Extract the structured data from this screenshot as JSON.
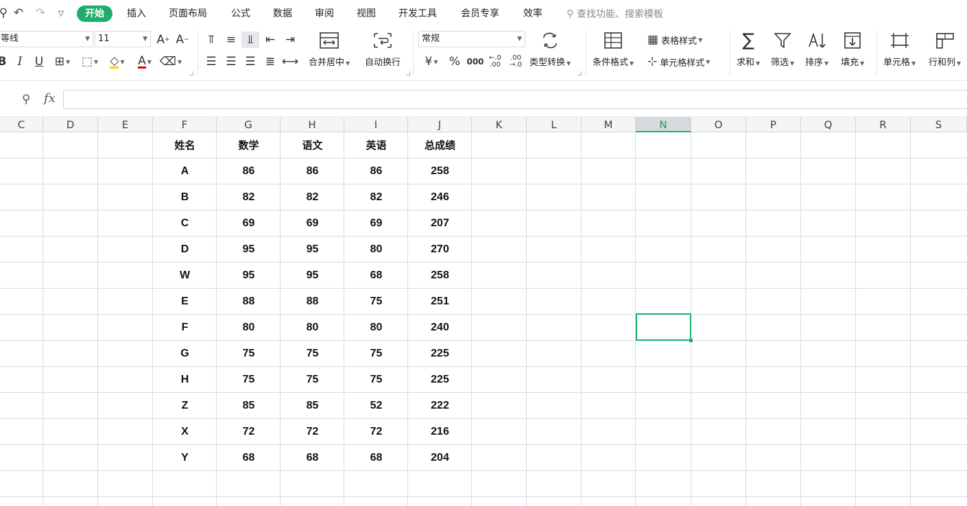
{
  "menubar": {
    "items": [
      "开始",
      "插入",
      "页面布局",
      "公式",
      "数据",
      "审阅",
      "视图",
      "开发工具",
      "会员专享",
      "效率"
    ],
    "active_index": 0,
    "search_placeholder": "查找功能、搜索模板"
  },
  "ribbon": {
    "font_name": "等线",
    "font_size": "11",
    "number_format": "常规",
    "merge_center": "合并居中",
    "auto_wrap": "自动换行",
    "type_convert": "类型转换",
    "conditional_format": "条件格式",
    "table_style": "表格样式",
    "cell_style": "单元格样式",
    "sum": "求和",
    "filter": "筛选",
    "sort": "排序",
    "fill": "填充",
    "cell": "单元格",
    "row_col": "行和列"
  },
  "formula_bar": {
    "fx": "fx",
    "value": ""
  },
  "columns": [
    "C",
    "D",
    "E",
    "F",
    "G",
    "H",
    "I",
    "J",
    "K",
    "L",
    "M",
    "N",
    "O",
    "P",
    "Q",
    "R",
    "S"
  ],
  "selected_column": "N",
  "table": {
    "headers": [
      "姓名",
      "数学",
      "语文",
      "英语",
      "总成绩"
    ],
    "rows": [
      [
        "A",
        "86",
        "86",
        "86",
        "258"
      ],
      [
        "B",
        "82",
        "82",
        "82",
        "246"
      ],
      [
        "C",
        "69",
        "69",
        "69",
        "207"
      ],
      [
        "D",
        "95",
        "95",
        "80",
        "270"
      ],
      [
        "W",
        "95",
        "95",
        "68",
        "258"
      ],
      [
        "E",
        "88",
        "88",
        "75",
        "251"
      ],
      [
        "F",
        "80",
        "80",
        "80",
        "240"
      ],
      [
        "G",
        "75",
        "75",
        "75",
        "225"
      ],
      [
        "H",
        "75",
        "75",
        "75",
        "225"
      ],
      [
        "Z",
        "85",
        "85",
        "52",
        "222"
      ],
      [
        "X",
        "72",
        "72",
        "72",
        "216"
      ],
      [
        "Y",
        "68",
        "68",
        "68",
        "204"
      ]
    ]
  },
  "colors": {
    "accent": "#1dae6a",
    "gridline": "#d8dbe6"
  }
}
